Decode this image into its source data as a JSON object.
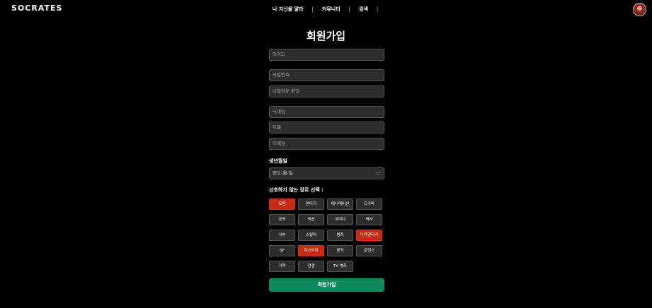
{
  "header": {
    "logo": "SOCRATES",
    "nav": [
      "나 자신을 알라",
      "커뮤니티",
      "검색"
    ]
  },
  "page": {
    "title": "회원가입"
  },
  "form": {
    "fields": [
      {
        "name": "id",
        "placeholder": "아이디"
      },
      {
        "name": "password",
        "placeholder": "비밀번호"
      },
      {
        "name": "password-confirm",
        "placeholder": "비밀번호 확인"
      },
      {
        "name": "nickname",
        "placeholder": "닉네임"
      },
      {
        "name": "name",
        "placeholder": "이름"
      },
      {
        "name": "email",
        "placeholder": "이메일"
      }
    ],
    "birth_label": "생년월일",
    "birth_placeholder": "연도-월-일",
    "genre_label": "선호하지 않는 장르 선택 :",
    "genres": [
      {
        "label": "모험",
        "selected": true
      },
      {
        "label": "판타지",
        "selected": false
      },
      {
        "label": "애니메이션",
        "selected": false
      },
      {
        "label": "드라마",
        "selected": false
      },
      {
        "label": "공포",
        "selected": false
      },
      {
        "label": "액션",
        "selected": false
      },
      {
        "label": "코미디",
        "selected": false
      },
      {
        "label": "역사",
        "selected": false
      },
      {
        "label": "서부",
        "selected": false
      },
      {
        "label": "스릴러",
        "selected": false
      },
      {
        "label": "범죄",
        "selected": false
      },
      {
        "label": "다큐멘터리",
        "selected": true
      },
      {
        "label": "SF",
        "selected": false
      },
      {
        "label": "미스터리",
        "selected": true
      },
      {
        "label": "음악",
        "selected": false
      },
      {
        "label": "로맨스",
        "selected": false
      },
      {
        "label": "가족",
        "selected": false
      },
      {
        "label": "전쟁",
        "selected": false
      },
      {
        "label": "TV 영화",
        "selected": false
      }
    ],
    "submit_label": "회원가입"
  },
  "colors": {
    "selected": "#c62a12",
    "submit": "#0c8a5b",
    "input_bg": "#2d2d2d"
  }
}
